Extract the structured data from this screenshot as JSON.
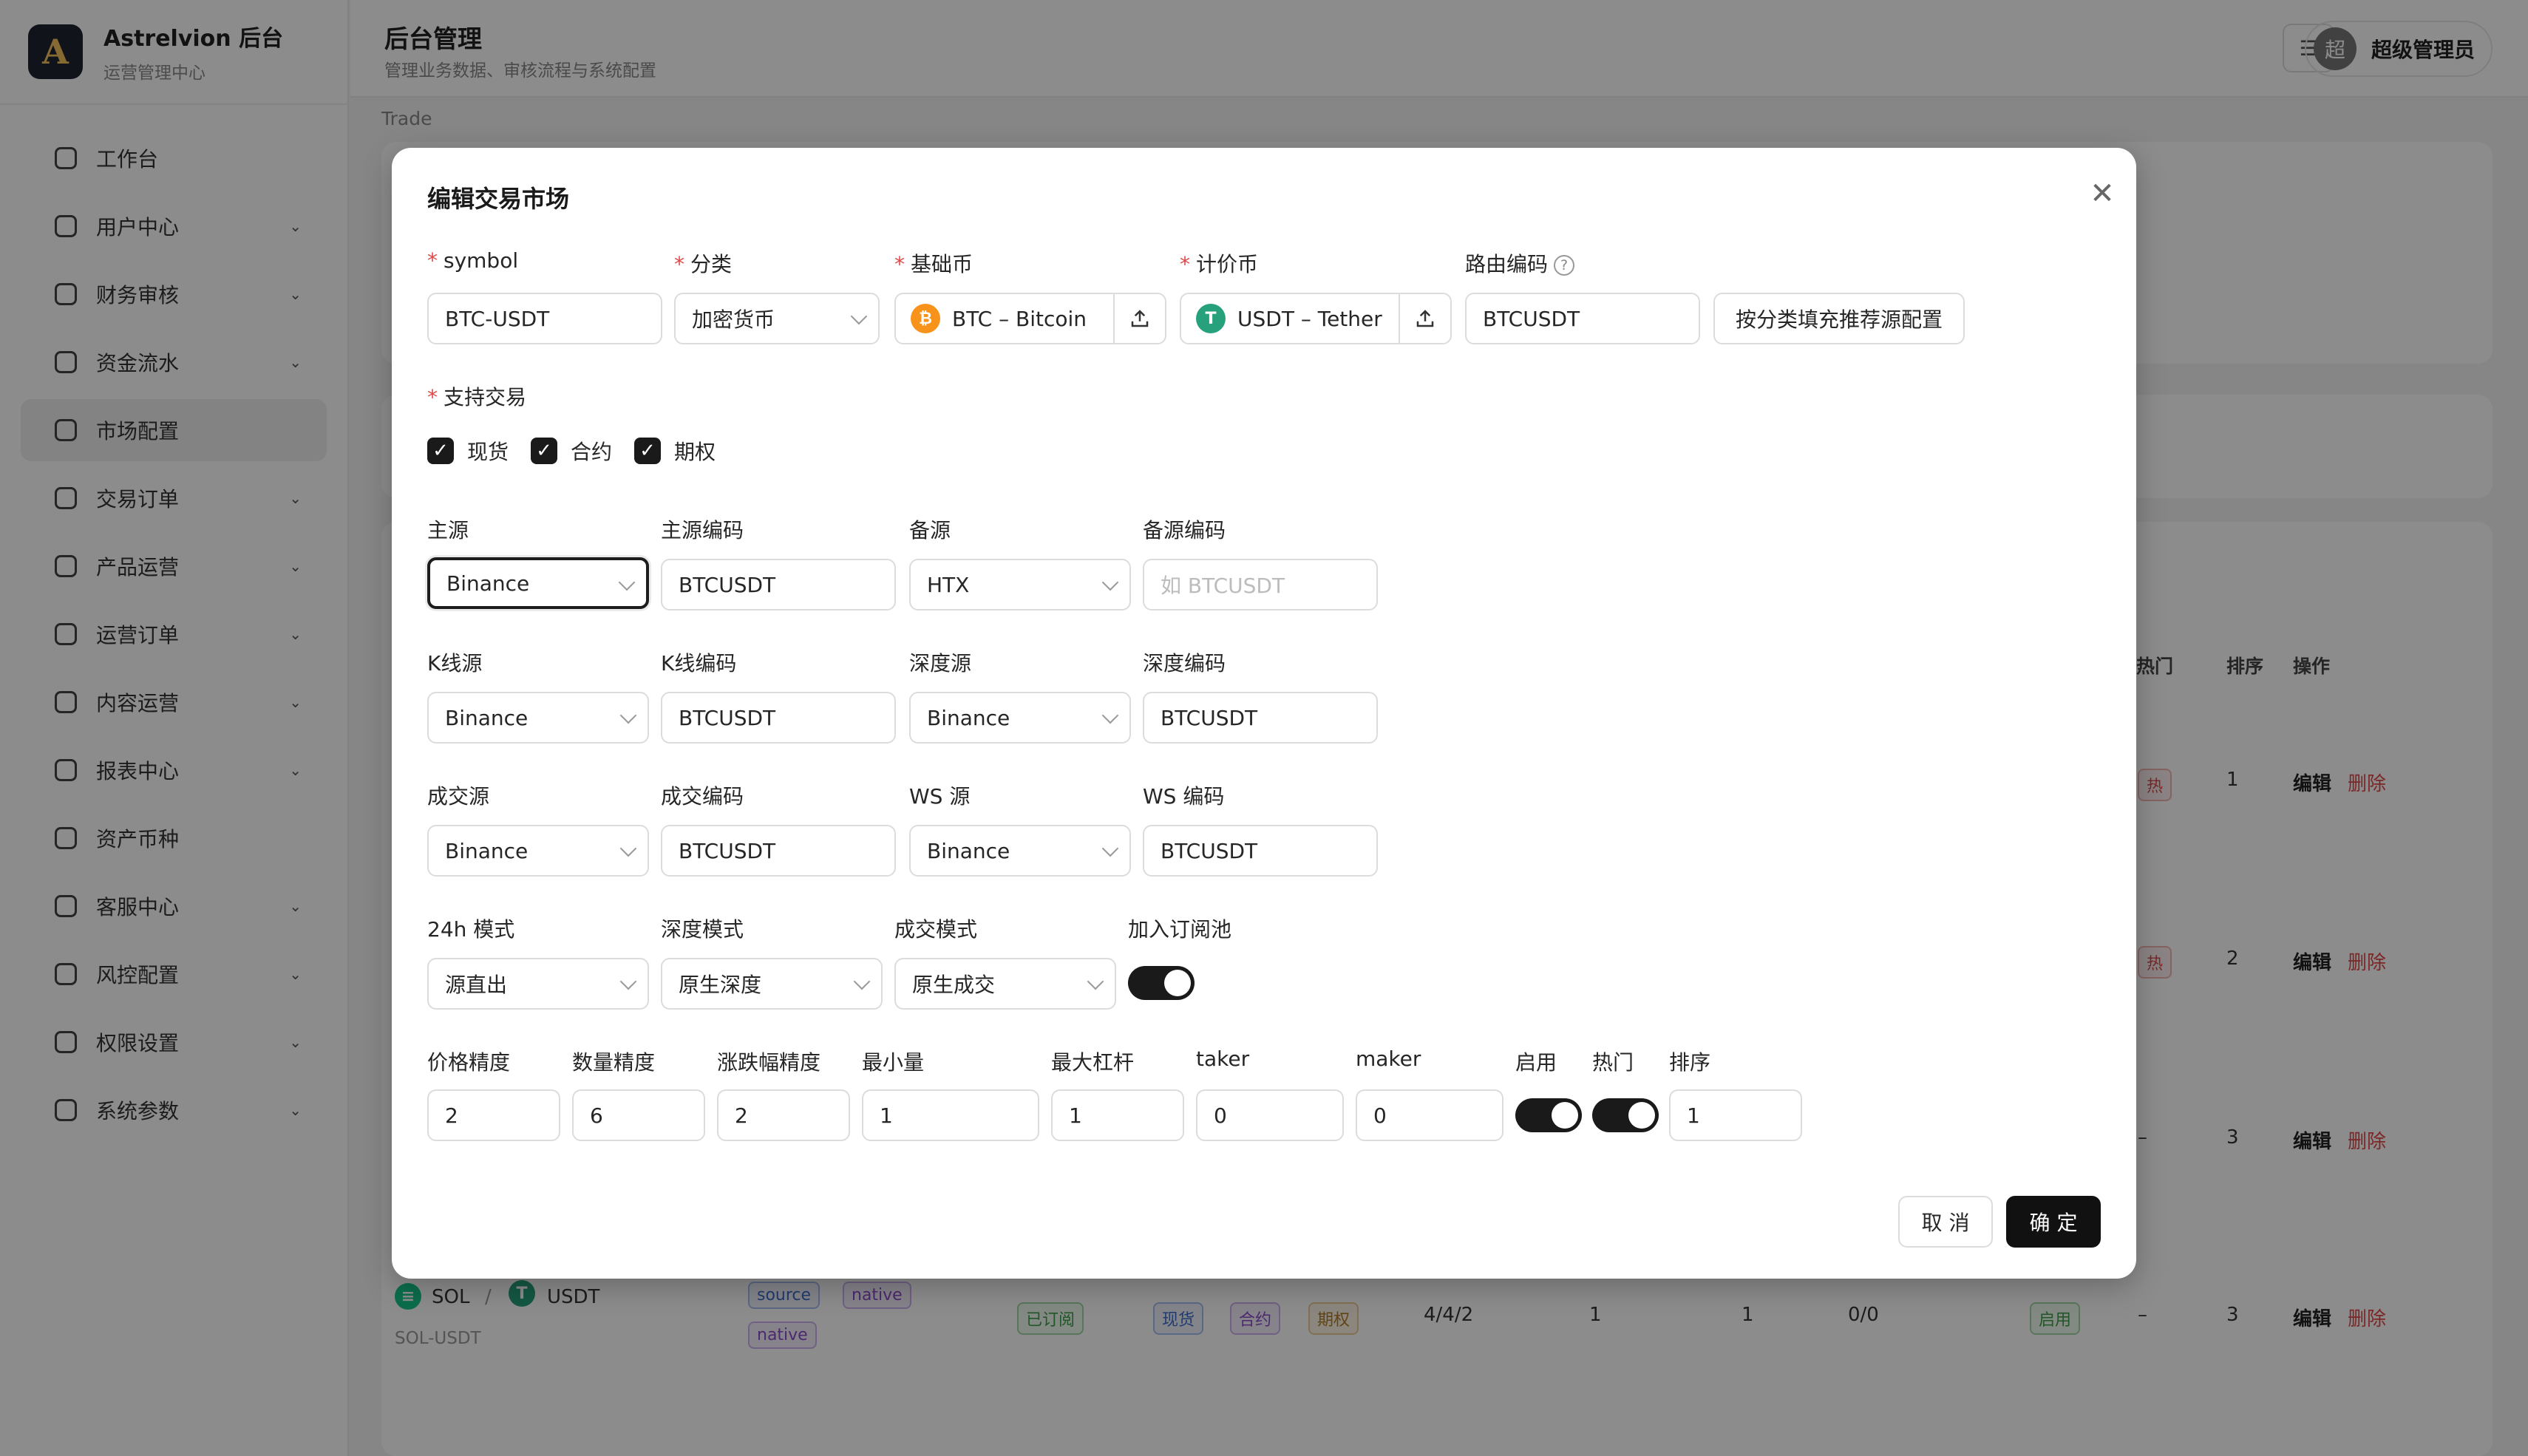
{
  "app": {
    "name": "Astrelvion 后台",
    "subtitle": "运营管理中心",
    "logo_letter": "A"
  },
  "sidebar": {
    "items": [
      {
        "label": "工作台",
        "icon": "dashboard-icon",
        "expandable": false
      },
      {
        "label": "用户中心",
        "icon": "user-icon",
        "expandable": true
      },
      {
        "label": "财务审核",
        "icon": "audit-icon",
        "expandable": true
      },
      {
        "label": "资金流水",
        "icon": "ledger-icon",
        "expandable": true
      },
      {
        "label": "市场配置",
        "icon": "chart-line-icon",
        "expandable": false,
        "active": true
      },
      {
        "label": "交易订单",
        "icon": "swap-icon",
        "expandable": true
      },
      {
        "label": "产品运营",
        "icon": "product-icon",
        "expandable": true
      },
      {
        "label": "运营订单",
        "icon": "calendar-icon",
        "expandable": true
      },
      {
        "label": "内容运营",
        "icon": "megaphone-icon",
        "expandable": true
      },
      {
        "label": "报表中心",
        "icon": "bar-chart-icon",
        "expandable": true
      },
      {
        "label": "资产币种",
        "icon": "bank-icon",
        "expandable": false
      },
      {
        "label": "客服中心",
        "icon": "headset-icon",
        "expandable": true
      },
      {
        "label": "风控配置",
        "icon": "shield-icon",
        "expandable": true
      },
      {
        "label": "权限设置",
        "icon": "gear-icon",
        "expandable": true
      },
      {
        "label": "系统参数",
        "icon": "document-icon",
        "expandable": true
      }
    ]
  },
  "header": {
    "title": "后台管理",
    "subtitle": "管理业务数据、审核流程与系统配置",
    "user_name": "超级管理员",
    "avatar_char": "超"
  },
  "breadcrumb": "Trade",
  "background_table": {
    "headers": {
      "hot": "热门",
      "sort": "排序",
      "actions": "操作"
    },
    "rows": [
      {
        "hot": "热",
        "sort": "1",
        "edit": "编辑",
        "delete": "删除"
      },
      {
        "hot": "热",
        "sort": "2",
        "edit": "编辑",
        "delete": "删除"
      },
      {
        "hot": "–",
        "sort": "3",
        "edit": "编辑",
        "delete": "删除"
      },
      {
        "base": "SOL",
        "sep": "/",
        "quote": "USDT",
        "symbol": "SOL-USDT",
        "source_tags": [
          "source",
          "native",
          "native"
        ],
        "subscribed": "已订阅",
        "trade_tags": [
          "现货",
          "合约",
          "期权"
        ],
        "precision": "4/4/2",
        "min_qty": "1",
        "max_leverage": "1",
        "fees": "0/0",
        "enabled": "启用",
        "hot": "–",
        "sort": "3",
        "edit": "编辑",
        "delete": "删除"
      }
    ]
  },
  "modal": {
    "title": "编辑交易市场",
    "row1": {
      "symbol_label": "symbol",
      "symbol_value": "BTC-USDT",
      "category_label": "分类",
      "category_value": "加密货币",
      "base_label": "基础币",
      "base_value": "BTC – Bitcoin",
      "quote_label": "计价币",
      "quote_value": "USDT – Tether",
      "route_label": "路由编码",
      "route_value": "BTCUSDT",
      "fill_button": "按分类填充推荐源配置"
    },
    "trade_types": {
      "label": "支持交易",
      "options": [
        {
          "label": "现货",
          "checked": true
        },
        {
          "label": "合约",
          "checked": true
        },
        {
          "label": "期权",
          "checked": true
        }
      ]
    },
    "sources": {
      "main_label": "主源",
      "main_value": "Binance",
      "main_code_label": "主源编码",
      "main_code_value": "BTCUSDT",
      "backup_label": "备源",
      "backup_value": "HTX",
      "backup_code_label": "备源编码",
      "backup_code_placeholder": "如 BTCUSDT",
      "kline_label": "K线源",
      "kline_value": "Binance",
      "kline_code_label": "K线编码",
      "kline_code_value": "BTCUSDT",
      "depth_label": "深度源",
      "depth_value": "Binance",
      "depth_code_label": "深度编码",
      "depth_code_value": "BTCUSDT",
      "deal_label": "成交源",
      "deal_value": "Binance",
      "deal_code_label": "成交编码",
      "deal_code_value": "BTCUSDT",
      "ws_label": "WS 源",
      "ws_value": "Binance",
      "ws_code_label": "WS 编码",
      "ws_code_value": "BTCUSDT"
    },
    "modes": {
      "h24_label": "24h 模式",
      "h24_value": "源直出",
      "depth_mode_label": "深度模式",
      "depth_mode_value": "原生深度",
      "deal_mode_label": "成交模式",
      "deal_mode_value": "原生成交",
      "pool_label": "加入订阅池",
      "pool_on": true
    },
    "precision": {
      "price_label": "价格精度",
      "price_value": "2",
      "qty_label": "数量精度",
      "qty_value": "6",
      "change_label": "涨跌幅精度",
      "change_value": "2",
      "min_label": "最小量",
      "min_value": "1",
      "leverage_label": "最大杠杆",
      "leverage_value": "1",
      "taker_label": "taker",
      "taker_value": "0",
      "maker_label": "maker",
      "maker_value": "0",
      "enabled_label": "启用",
      "enabled_on": true,
      "hot_label": "热门",
      "hot_on": true,
      "sort_label": "排序",
      "sort_value": "1"
    },
    "footer": {
      "cancel": "取 消",
      "confirm": "确 定"
    }
  },
  "colors": {
    "btc": "#f7931a",
    "usdt": "#26a17b",
    "sol": "#14f195",
    "danger": "#e04848",
    "primary": "#111111"
  }
}
